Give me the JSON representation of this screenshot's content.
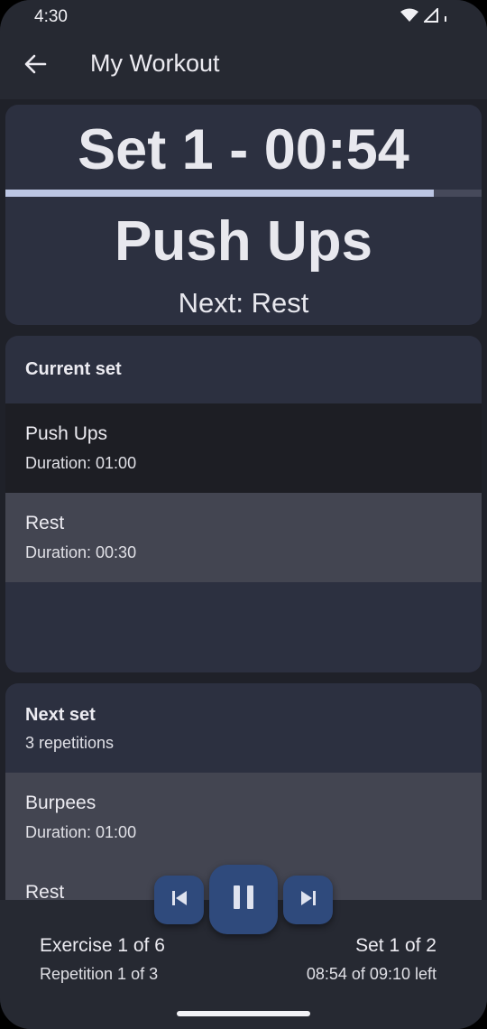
{
  "status_bar": {
    "time": "4:30",
    "icons": [
      "wifi-icon",
      "signal-icon",
      "battery-icon"
    ]
  },
  "app_bar": {
    "title": "My Workout",
    "back_icon": "arrow-back-icon"
  },
  "timer": {
    "label": "Set 1 - 00:54",
    "progress": 0.9,
    "exercise": "Push Ups",
    "next": "Next: Rest"
  },
  "current_set": {
    "header": "Current set",
    "items": [
      {
        "title": "Push Ups",
        "duration": "Duration: 01:00",
        "state": "active"
      },
      {
        "title": "Rest",
        "duration": "Duration: 00:30",
        "state": "upcoming"
      }
    ]
  },
  "next_set": {
    "header": "Next set",
    "subtitle": "3 repetitions",
    "items": [
      {
        "title": "Burpees",
        "duration": "Duration: 01:00"
      },
      {
        "title": "Rest"
      }
    ]
  },
  "controls": {
    "prev_icon": "skip-previous-icon",
    "pause_icon": "pause-icon",
    "next_icon": "skip-next-icon"
  },
  "footer": {
    "exercise": "Exercise 1 of 6",
    "repetition": "Repetition 1 of 3",
    "set": "Set 1 of 2",
    "time_left": "08:54 of 09:10 left"
  },
  "colors": {
    "background": "#1f2129",
    "card": "#2c3040",
    "accent_button": "#2f4a7c",
    "progress_fill": "#bcc6e4"
  }
}
